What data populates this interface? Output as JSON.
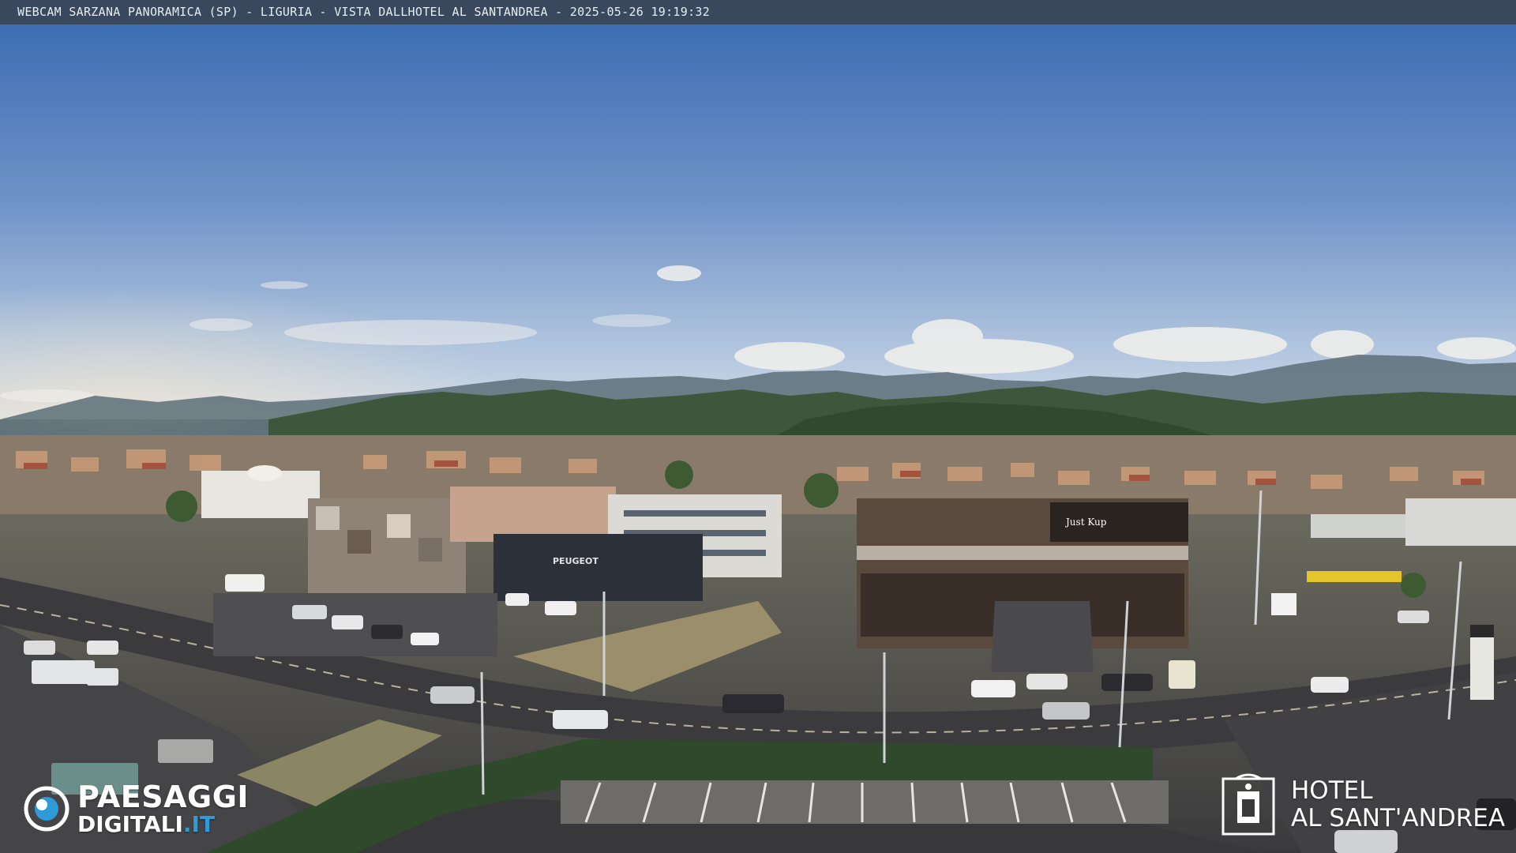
{
  "header": {
    "caption": "WEBCAM SARZANA PANORAMICA (SP) - LIGURIA - VISTA DALLHOTEL AL SANTANDREA - 2025-05-26  19:19:32"
  },
  "scene": {
    "description_icon": "landscape-photo",
    "signs": {
      "peugeot": "PEUGEOT",
      "restaurant_logo": "Just Kup"
    }
  },
  "watermark_left": {
    "line1": "PAESAGGI",
    "line2_main": "DIGITALI",
    "line2_tld": ".IT"
  },
  "watermark_right": {
    "line1": "HOTEL",
    "line2": "AL SANT'ANDREA"
  },
  "colors": {
    "sky_top": "#3f6fb5",
    "sky_bottom": "#b9cde3",
    "hills": "#3b5a3e",
    "road": "#3d3d40",
    "accent_blue": "#2e9ad8"
  }
}
